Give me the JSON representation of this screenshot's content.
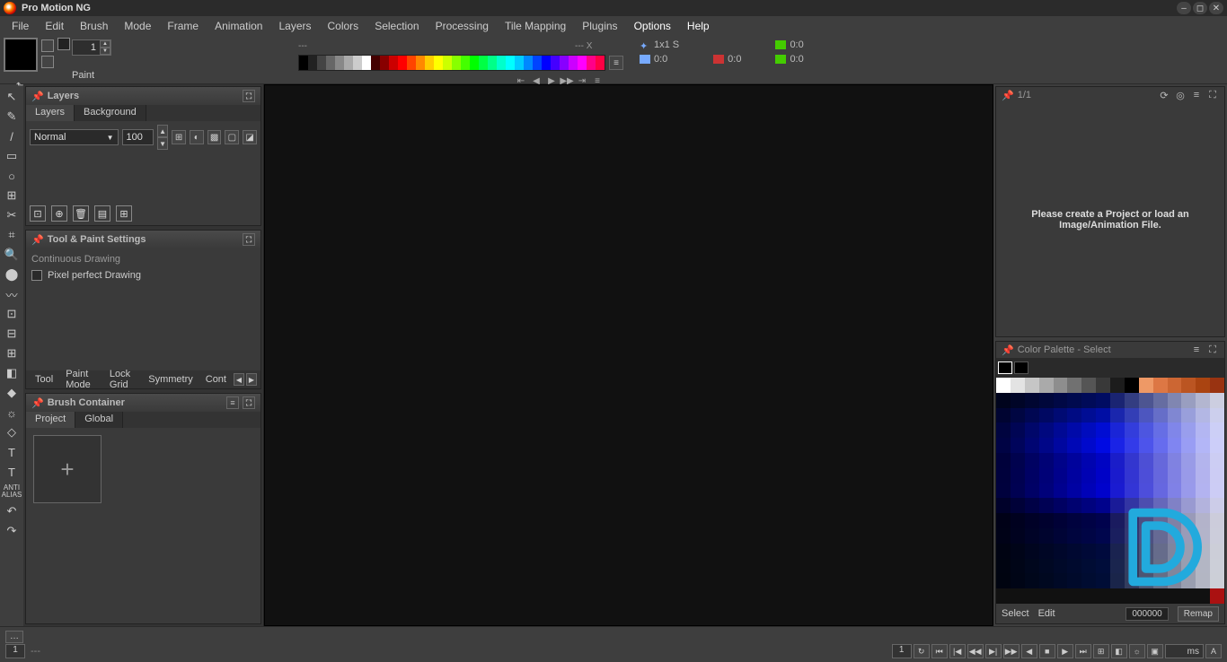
{
  "app": {
    "title": "Pro Motion NG"
  },
  "menu": [
    "File",
    "Edit",
    "Brush",
    "Mode",
    "Frame",
    "Animation",
    "Layers",
    "Colors",
    "Selection",
    "Processing",
    "Tile Mapping",
    "Plugins",
    "Options",
    "Help"
  ],
  "menu_active": [
    12,
    13
  ],
  "toolbar": {
    "size_value": "1",
    "paint_label": "Paint",
    "info_top_left": "---",
    "info_top_right": "--- X",
    "brush_dim": "1x1 S",
    "time1": "0:0",
    "time2": "0:0",
    "time3": "0:0",
    "time4": "0:0",
    "sep": "---"
  },
  "palette_strip": [
    "#000",
    "#222",
    "#444",
    "#666",
    "#888",
    "#aaa",
    "#ccc",
    "#fff",
    "#400",
    "#800",
    "#c00",
    "#f00",
    "#f40",
    "#f80",
    "#fc0",
    "#ff0",
    "#cf0",
    "#8f0",
    "#4f0",
    "#0f0",
    "#0f4",
    "#0f8",
    "#0fc",
    "#0ff",
    "#0cf",
    "#08f",
    "#04f",
    "#00f",
    "#40f",
    "#80f",
    "#c0f",
    "#f0f",
    "#f08",
    "#f04"
  ],
  "panels": {
    "layers": {
      "title": "Layers",
      "tabs": [
        "Layers",
        "Background"
      ],
      "active_tab": 0,
      "blend": "Normal",
      "opacity": "100"
    },
    "settings": {
      "title": "Tool & Paint Settings",
      "sub": "Continuous Drawing",
      "checkbox": "Pixel perfect Drawing",
      "tabs": [
        "Tool",
        "Paint Mode",
        "Lock Grid",
        "Symmetry",
        "Cont"
      ]
    },
    "brush": {
      "title": "Brush Container",
      "tabs": [
        "Project",
        "Global"
      ],
      "active_tab": 0
    }
  },
  "preview": {
    "counter": "1/1",
    "message": "Please create a Project or load an Image/Animation File."
  },
  "color_palette": {
    "title": "Color Palette - Select",
    "footer": {
      "select": "Select",
      "edit": "Edit",
      "hex": "000000",
      "remap": "Remap"
    }
  },
  "status": {
    "page_left": "1",
    "dash": "---",
    "page_right": "1",
    "ms": "ms",
    "a": "A"
  },
  "tool_icons": [
    "↖",
    "✎",
    "/",
    "▭",
    "○",
    "⊞",
    "✂",
    "⌗",
    "🔍",
    "⬤",
    "〰",
    "⊡",
    "⊟",
    "⊞",
    "◧",
    "◆",
    "☼",
    "◇",
    "T",
    "T",
    "ANTI\nALIAS",
    "↶",
    "↷"
  ],
  "cpal_hues": [
    "#888",
    "#c62",
    "#ea4",
    "#dd3",
    "#ae3",
    "#4c3",
    "#2c7",
    "#2cc",
    "#28c",
    "#24d",
    "#64d",
    "#a3d",
    "#d3a",
    "#d36",
    "#333"
  ]
}
